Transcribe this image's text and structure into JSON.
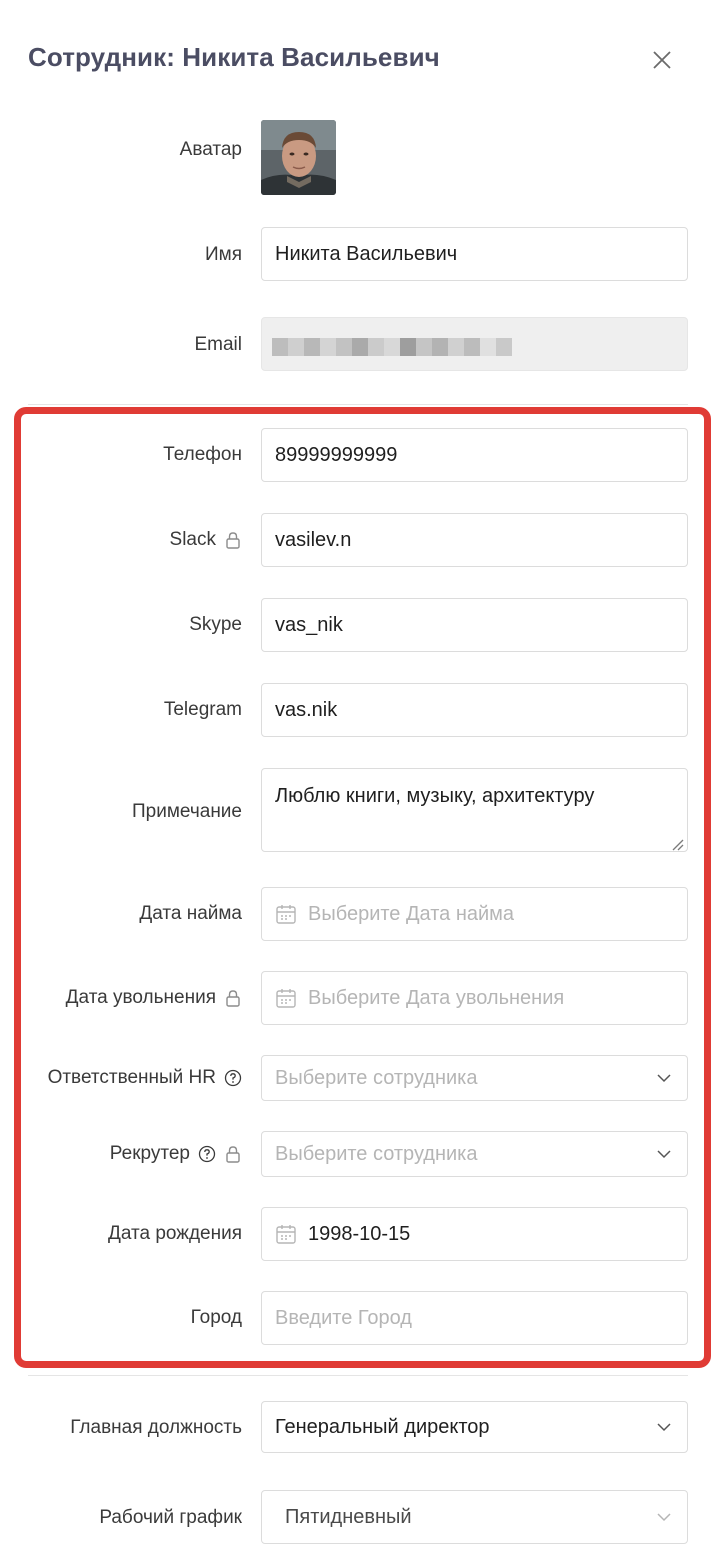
{
  "title": "Сотрудник: Никита Васильевич",
  "form": {
    "avatar_label": "Аватар",
    "name": {
      "label": "Имя",
      "value": "Никита Васильевич"
    },
    "email": {
      "label": "Email",
      "value": ""
    },
    "phone": {
      "label": "Телефон",
      "value": "89999999999"
    },
    "slack": {
      "label": "Slack",
      "value": "vasilev.n"
    },
    "skype": {
      "label": "Skype",
      "value": "vas_nik"
    },
    "telegram": {
      "label": "Telegram",
      "value": "vas.nik"
    },
    "note": {
      "label": "Примечание",
      "value": "Люблю книги, музыку, архитектуру"
    },
    "hire_date": {
      "label": "Дата найма",
      "placeholder": "Выберите Дата найма"
    },
    "fire_date": {
      "label": "Дата увольнения",
      "placeholder": "Выберите Дата увольнения"
    },
    "hr": {
      "label": "Ответственный HR",
      "placeholder": "Выберите сотрудника"
    },
    "recruiter": {
      "label": "Рекрутер",
      "placeholder": "Выберите сотрудника"
    },
    "birth_date": {
      "label": "Дата рождения",
      "value": "1998-10-15"
    },
    "city": {
      "label": "Город",
      "placeholder": "Введите Город"
    },
    "position": {
      "label": "Главная должность",
      "value": "Генеральный директор"
    },
    "schedule": {
      "label": "Рабочий график",
      "value": "Пятидневный"
    }
  },
  "colors": {
    "highlight": "#e03b35",
    "title": "#4b4d63",
    "placeholder": "#b5b5b5"
  }
}
